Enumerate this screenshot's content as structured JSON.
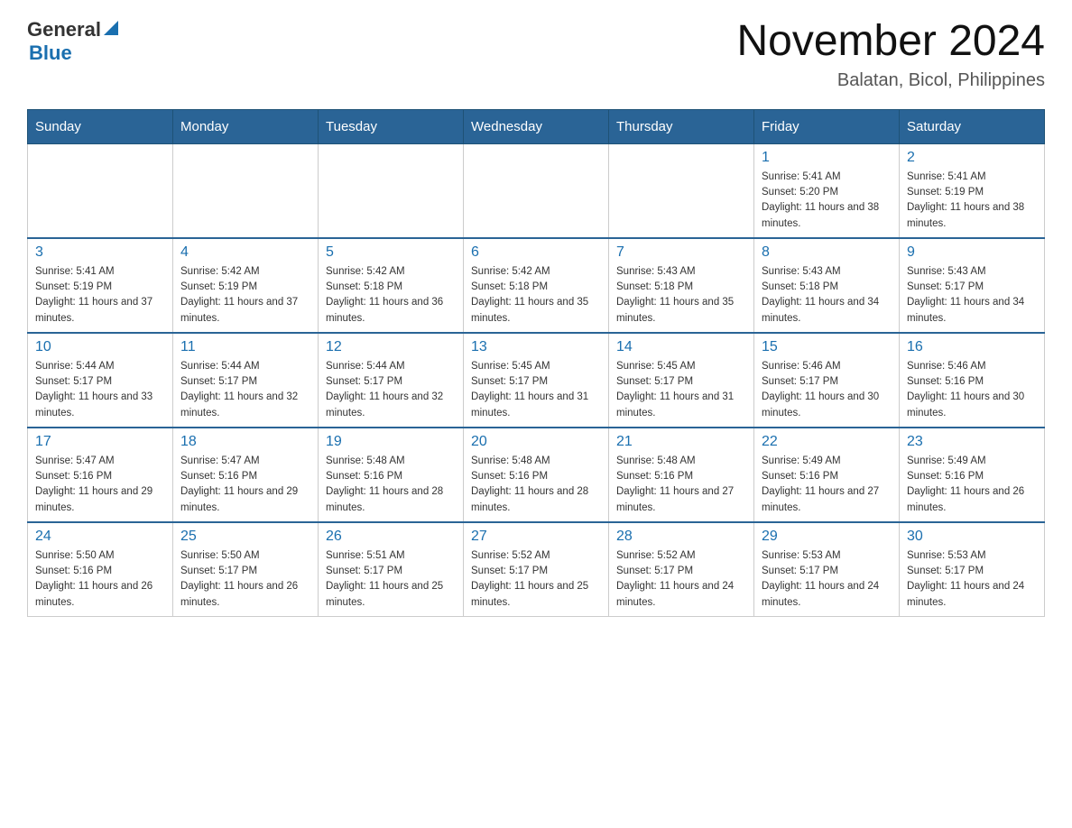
{
  "header": {
    "logo_general": "General",
    "logo_blue": "Blue",
    "month_year": "November 2024",
    "location": "Balatan, Bicol, Philippines"
  },
  "days_of_week": [
    "Sunday",
    "Monday",
    "Tuesday",
    "Wednesday",
    "Thursday",
    "Friday",
    "Saturday"
  ],
  "weeks": [
    {
      "days": [
        {
          "num": "",
          "info": ""
        },
        {
          "num": "",
          "info": ""
        },
        {
          "num": "",
          "info": ""
        },
        {
          "num": "",
          "info": ""
        },
        {
          "num": "",
          "info": ""
        },
        {
          "num": "1",
          "info": "Sunrise: 5:41 AM\nSunset: 5:20 PM\nDaylight: 11 hours and 38 minutes."
        },
        {
          "num": "2",
          "info": "Sunrise: 5:41 AM\nSunset: 5:19 PM\nDaylight: 11 hours and 38 minutes."
        }
      ]
    },
    {
      "days": [
        {
          "num": "3",
          "info": "Sunrise: 5:41 AM\nSunset: 5:19 PM\nDaylight: 11 hours and 37 minutes."
        },
        {
          "num": "4",
          "info": "Sunrise: 5:42 AM\nSunset: 5:19 PM\nDaylight: 11 hours and 37 minutes."
        },
        {
          "num": "5",
          "info": "Sunrise: 5:42 AM\nSunset: 5:18 PM\nDaylight: 11 hours and 36 minutes."
        },
        {
          "num": "6",
          "info": "Sunrise: 5:42 AM\nSunset: 5:18 PM\nDaylight: 11 hours and 35 minutes."
        },
        {
          "num": "7",
          "info": "Sunrise: 5:43 AM\nSunset: 5:18 PM\nDaylight: 11 hours and 35 minutes."
        },
        {
          "num": "8",
          "info": "Sunrise: 5:43 AM\nSunset: 5:18 PM\nDaylight: 11 hours and 34 minutes."
        },
        {
          "num": "9",
          "info": "Sunrise: 5:43 AM\nSunset: 5:17 PM\nDaylight: 11 hours and 34 minutes."
        }
      ]
    },
    {
      "days": [
        {
          "num": "10",
          "info": "Sunrise: 5:44 AM\nSunset: 5:17 PM\nDaylight: 11 hours and 33 minutes."
        },
        {
          "num": "11",
          "info": "Sunrise: 5:44 AM\nSunset: 5:17 PM\nDaylight: 11 hours and 32 minutes."
        },
        {
          "num": "12",
          "info": "Sunrise: 5:44 AM\nSunset: 5:17 PM\nDaylight: 11 hours and 32 minutes."
        },
        {
          "num": "13",
          "info": "Sunrise: 5:45 AM\nSunset: 5:17 PM\nDaylight: 11 hours and 31 minutes."
        },
        {
          "num": "14",
          "info": "Sunrise: 5:45 AM\nSunset: 5:17 PM\nDaylight: 11 hours and 31 minutes."
        },
        {
          "num": "15",
          "info": "Sunrise: 5:46 AM\nSunset: 5:17 PM\nDaylight: 11 hours and 30 minutes."
        },
        {
          "num": "16",
          "info": "Sunrise: 5:46 AM\nSunset: 5:16 PM\nDaylight: 11 hours and 30 minutes."
        }
      ]
    },
    {
      "days": [
        {
          "num": "17",
          "info": "Sunrise: 5:47 AM\nSunset: 5:16 PM\nDaylight: 11 hours and 29 minutes."
        },
        {
          "num": "18",
          "info": "Sunrise: 5:47 AM\nSunset: 5:16 PM\nDaylight: 11 hours and 29 minutes."
        },
        {
          "num": "19",
          "info": "Sunrise: 5:48 AM\nSunset: 5:16 PM\nDaylight: 11 hours and 28 minutes."
        },
        {
          "num": "20",
          "info": "Sunrise: 5:48 AM\nSunset: 5:16 PM\nDaylight: 11 hours and 28 minutes."
        },
        {
          "num": "21",
          "info": "Sunrise: 5:48 AM\nSunset: 5:16 PM\nDaylight: 11 hours and 27 minutes."
        },
        {
          "num": "22",
          "info": "Sunrise: 5:49 AM\nSunset: 5:16 PM\nDaylight: 11 hours and 27 minutes."
        },
        {
          "num": "23",
          "info": "Sunrise: 5:49 AM\nSunset: 5:16 PM\nDaylight: 11 hours and 26 minutes."
        }
      ]
    },
    {
      "days": [
        {
          "num": "24",
          "info": "Sunrise: 5:50 AM\nSunset: 5:16 PM\nDaylight: 11 hours and 26 minutes."
        },
        {
          "num": "25",
          "info": "Sunrise: 5:50 AM\nSunset: 5:17 PM\nDaylight: 11 hours and 26 minutes."
        },
        {
          "num": "26",
          "info": "Sunrise: 5:51 AM\nSunset: 5:17 PM\nDaylight: 11 hours and 25 minutes."
        },
        {
          "num": "27",
          "info": "Sunrise: 5:52 AM\nSunset: 5:17 PM\nDaylight: 11 hours and 25 minutes."
        },
        {
          "num": "28",
          "info": "Sunrise: 5:52 AM\nSunset: 5:17 PM\nDaylight: 11 hours and 24 minutes."
        },
        {
          "num": "29",
          "info": "Sunrise: 5:53 AM\nSunset: 5:17 PM\nDaylight: 11 hours and 24 minutes."
        },
        {
          "num": "30",
          "info": "Sunrise: 5:53 AM\nSunset: 5:17 PM\nDaylight: 11 hours and 24 minutes."
        }
      ]
    }
  ]
}
